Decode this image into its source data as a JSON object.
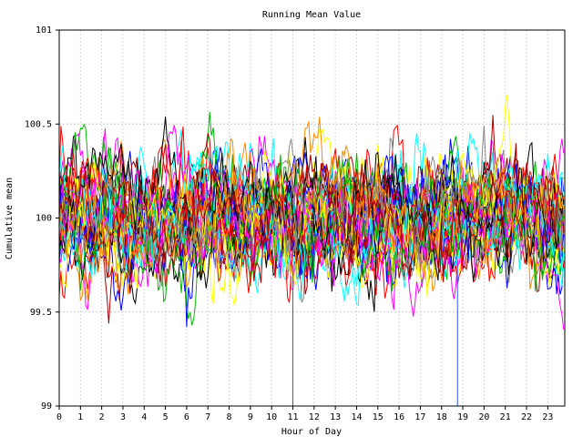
{
  "chart_data": {
    "type": "line",
    "title": "Running Mean Value",
    "xlabel": "Hour of Day",
    "ylabel": "Cumulative mean",
    "xlim": [
      0,
      23.8
    ],
    "ylim": [
      99,
      101
    ],
    "x_ticks": [
      0,
      1,
      2,
      3,
      4,
      5,
      6,
      7,
      8,
      9,
      10,
      11,
      12,
      13,
      14,
      15,
      16,
      17,
      18,
      19,
      20,
      21,
      22,
      23
    ],
    "x_tick_labels": [
      "0",
      "1",
      "2",
      "3",
      "4",
      "5",
      "6",
      "7",
      "8",
      "9",
      "10",
      "11",
      "12",
      "13",
      "14",
      "15",
      "16",
      "17",
      "18",
      "19",
      "20",
      "21",
      "22",
      "23"
    ],
    "y_ticks": [
      99,
      99.5,
      100,
      100.5,
      101
    ],
    "y_tick_labels": [
      "99",
      "99.5",
      "100",
      "100.5",
      "101"
    ],
    "grid": true,
    "legend": "none",
    "series_colors": [
      "#ff0000",
      "#0000ff",
      "#00bb00",
      "#ff00ff",
      "#00ffff",
      "#ffff00",
      "#000000",
      "#ff8800",
      "#888888",
      "#aa0000"
    ],
    "series_count": 40,
    "center_value": 100,
    "typical_band": [
      99.55,
      100.45
    ],
    "extremes": {
      "max": 100.78,
      "min": 99.22
    },
    "spikes": [
      {
        "x": 11.0,
        "y_low": 99.0
      },
      {
        "x": 18.75,
        "y_low": 99.0
      }
    ]
  }
}
